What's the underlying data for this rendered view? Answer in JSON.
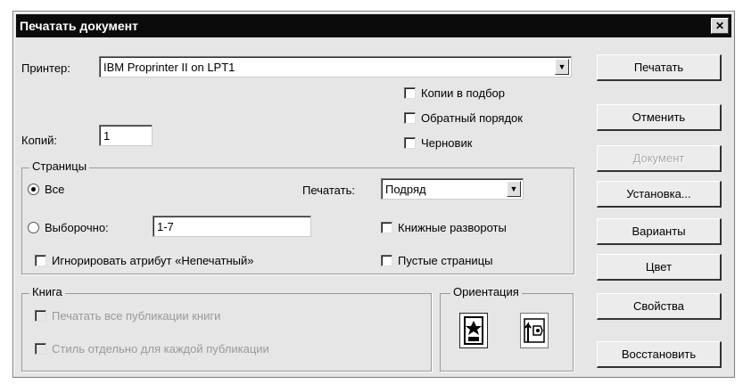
{
  "window": {
    "title": "Печатать документ",
    "close_glyph": "✕"
  },
  "printer": {
    "label": "Принтер:",
    "value": "IBM Proprinter II on LPT1"
  },
  "copies": {
    "label": "Копий:",
    "value": "1"
  },
  "options": {
    "collate": "Копии в подбор",
    "reverse": "Обратный порядок",
    "draft": "Черновик"
  },
  "pages": {
    "title": "Страницы",
    "all": "Все",
    "selection": "Выборочно:",
    "range_value": "1-7",
    "print_label": "Печатать:",
    "print_value": "Подряд",
    "book_spreads": "Книжные развороты",
    "ignore_attr": "Игнорировать атрибут «Непечатный»",
    "blank_pages": "Пустые страницы"
  },
  "book": {
    "title": "Книга",
    "print_all": "Печатать все публикации книги",
    "separate": "Стиль отдельно для каждой публикации"
  },
  "orientation": {
    "title": "Ориентация"
  },
  "buttons": {
    "print": "Печатать",
    "cancel": "Отменить",
    "document": "Документ",
    "setup": "Установка...",
    "variants": "Варианты",
    "color": "Цвет",
    "properties": "Свойства",
    "restore": "Восстановить"
  }
}
